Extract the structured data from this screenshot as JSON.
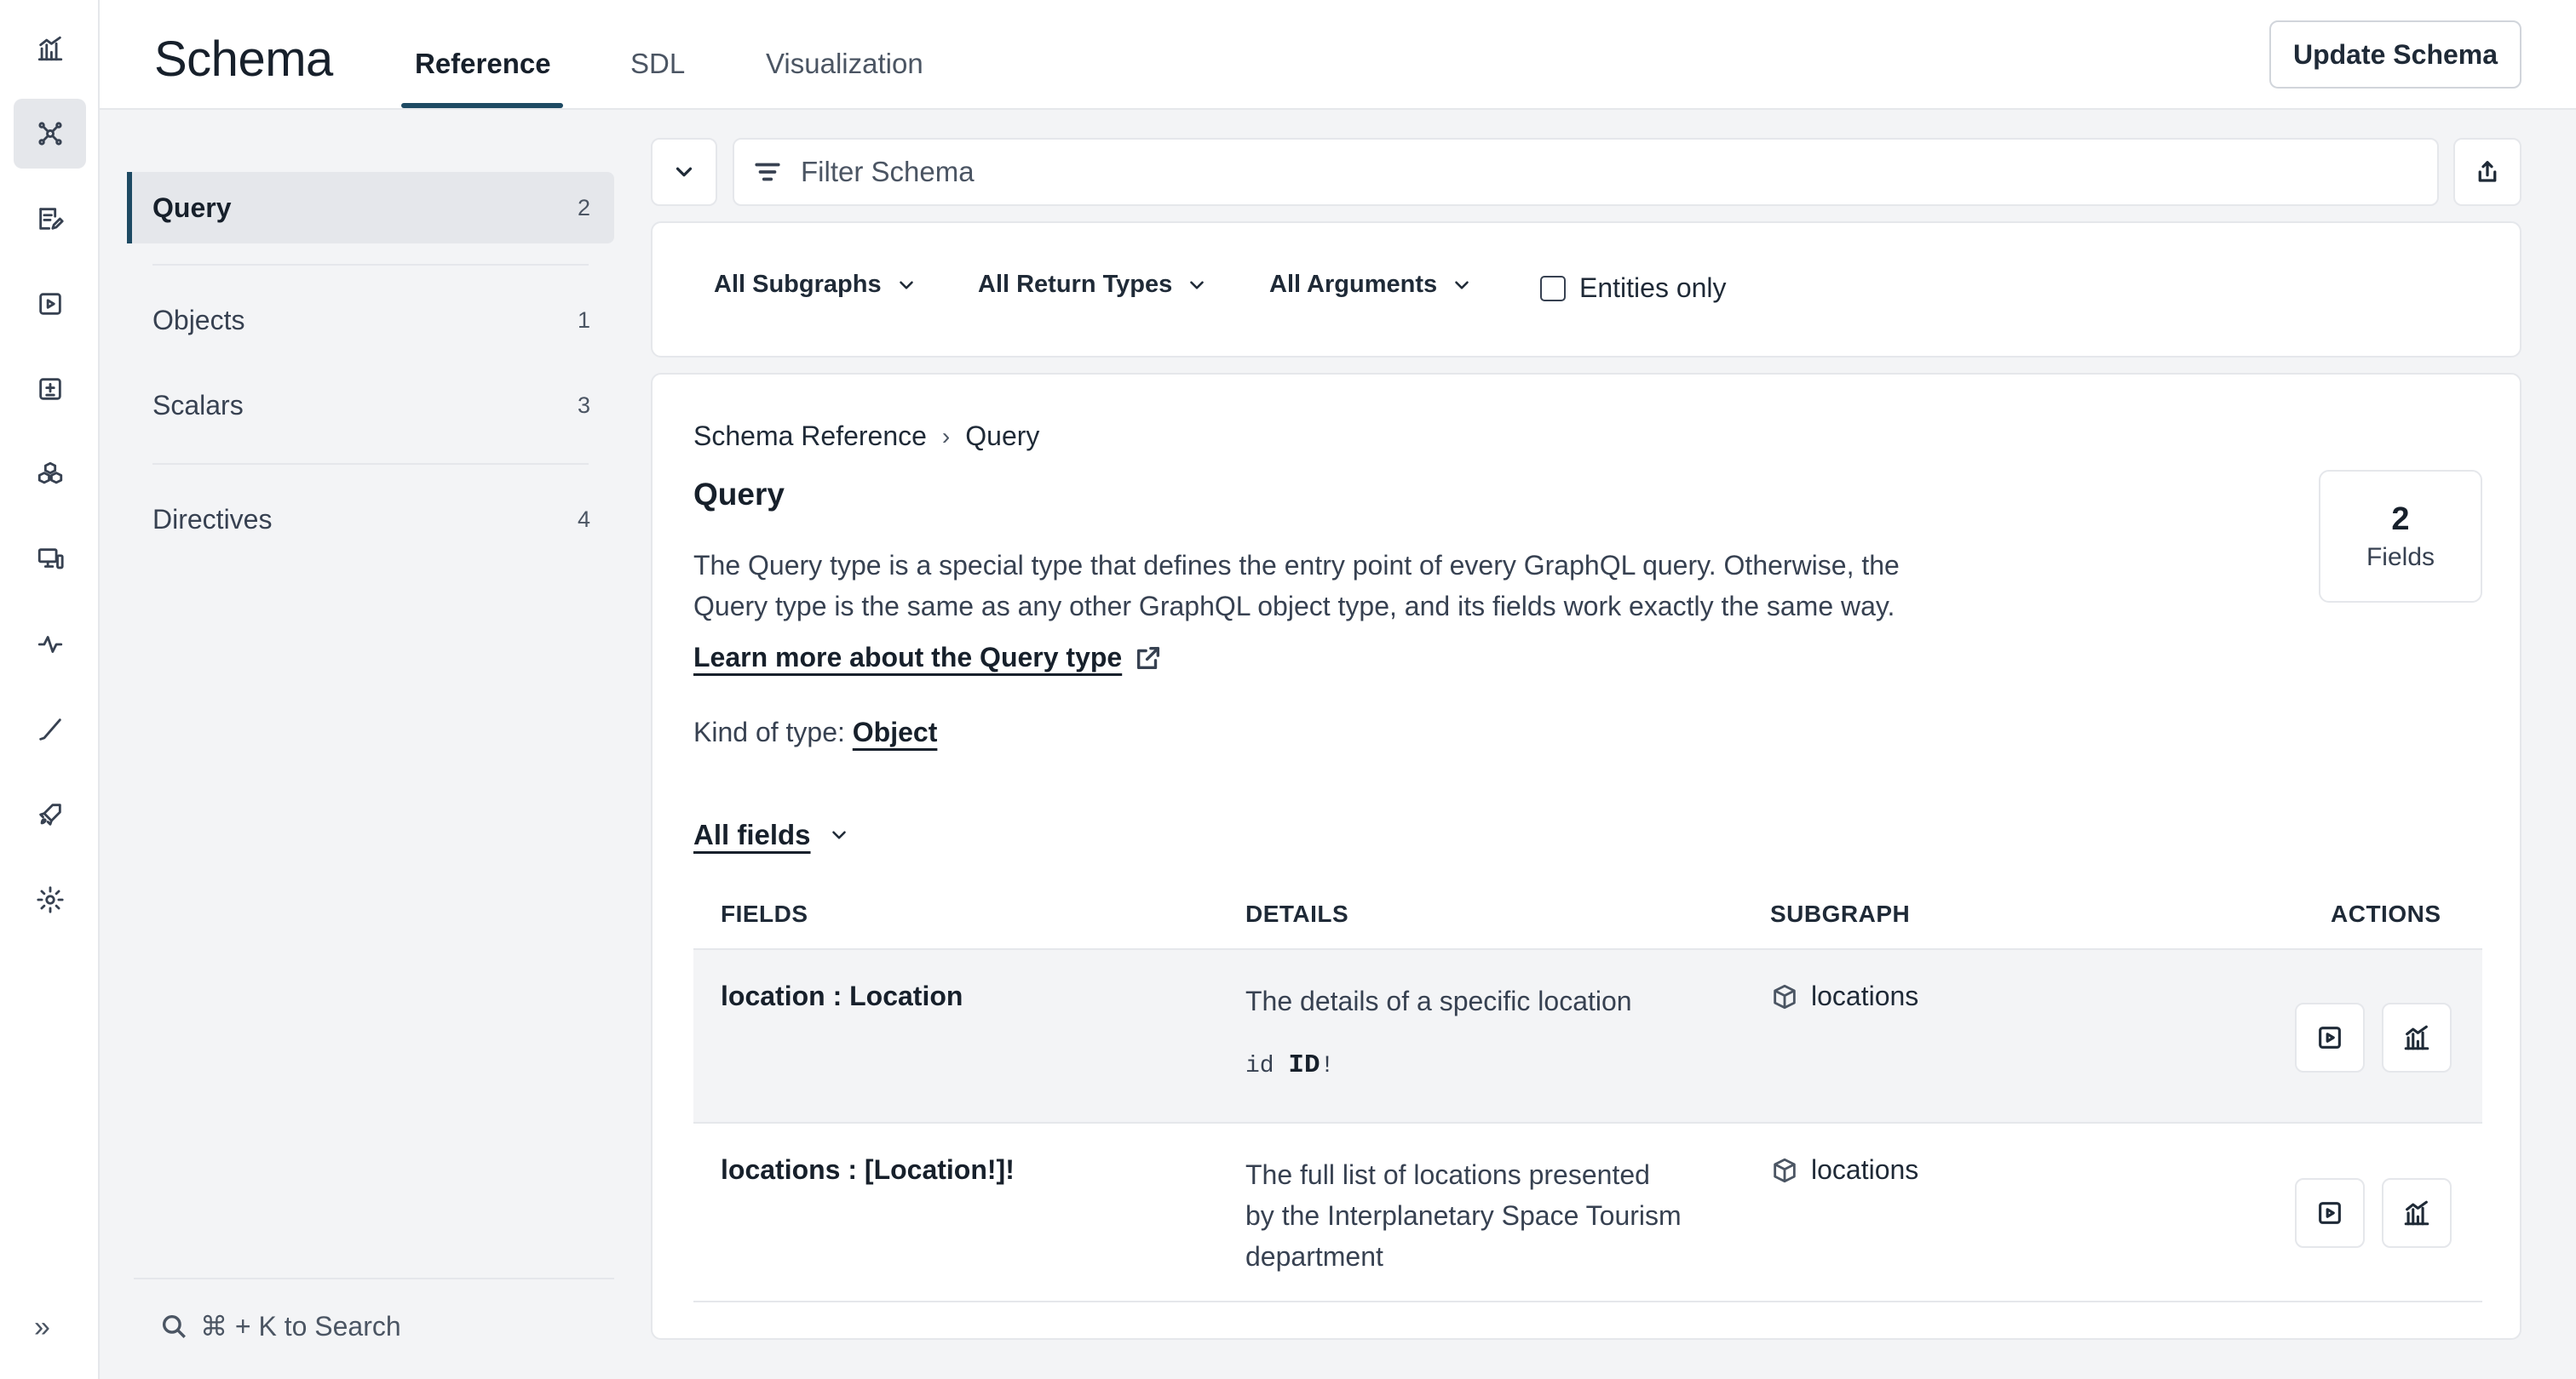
{
  "rail": {
    "icons": [
      "chart-icon",
      "graph-icon",
      "edit-icon",
      "play-icon",
      "plus-square-icon",
      "cubes-icon",
      "monitor-icon",
      "pulse-icon",
      "check-icon",
      "rocket-icon",
      "gear-icon",
      "expand-icon"
    ]
  },
  "header": {
    "title": "Schema",
    "tabs": [
      {
        "label": "Reference"
      },
      {
        "label": "SDL"
      },
      {
        "label": "Visualization"
      }
    ],
    "update_button": "Update Schema"
  },
  "sidebar": {
    "items": [
      {
        "label": "Query",
        "count": "2"
      },
      {
        "label": "Objects",
        "count": "1"
      },
      {
        "label": "Scalars",
        "count": "3"
      },
      {
        "label": "Directives",
        "count": "4"
      }
    ],
    "search_label": "⌘ + K to Search"
  },
  "filter": {
    "placeholder": "Filter Schema",
    "subgraphs": "All Subgraphs",
    "return_types": "All Return Types",
    "arguments": "All Arguments",
    "entities_only": "Entities only"
  },
  "content": {
    "breadcrumb": [
      "Schema Reference",
      "Query"
    ],
    "title": "Query",
    "description_line1": "The Query type is a special type that defines the entry point of every GraphQL query. Otherwise, the",
    "description_line2": "Query type is the same as any other GraphQL object type, and its fields work exactly the same way.",
    "learn_more": "Learn more about the Query type",
    "kind_label": "Kind of type:",
    "kind_value": "Object",
    "fields_count": "2",
    "fields_label": "Fields",
    "all_fields": "All fields"
  },
  "table": {
    "headers": [
      "FIELDS",
      "DETAILS",
      "SUBGRAPH",
      "ACTIONS"
    ],
    "rows": [
      {
        "field": "location : Location",
        "details_line1": "The details of a specific location",
        "arg_name": "id",
        "arg_type": "ID",
        "arg_suffix": "!",
        "subgraph": "locations"
      },
      {
        "field": "locations : [Location!]!",
        "details_line1": "The full list of locations presented",
        "details_line2": "by the Interplanetary Space Tourism",
        "details_line3": "department",
        "subgraph": "locations"
      }
    ]
  }
}
